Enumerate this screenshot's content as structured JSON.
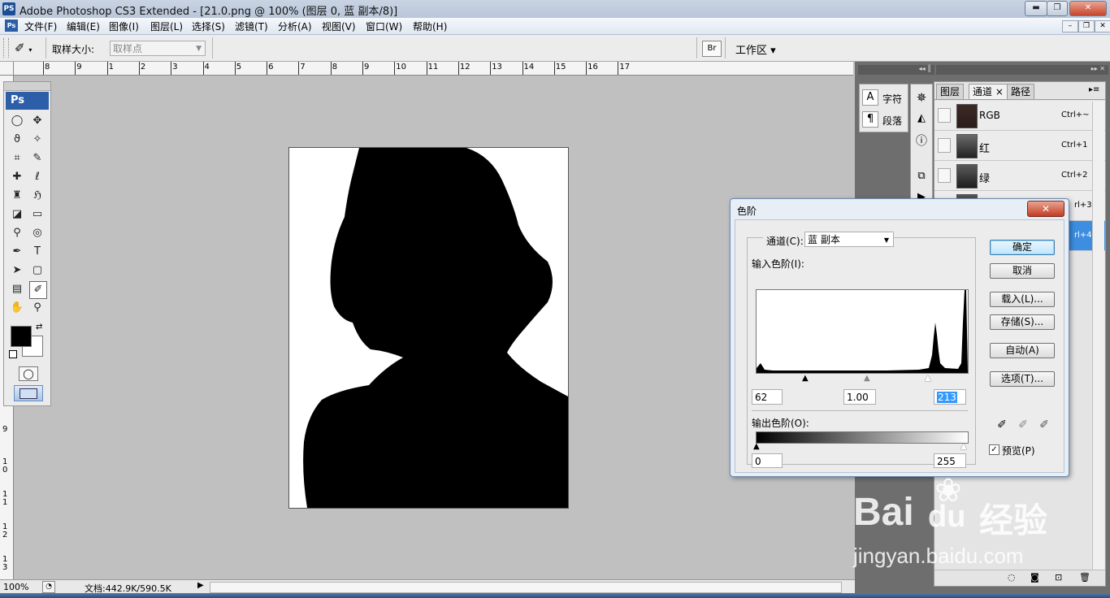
{
  "titlebar": {
    "app_icon": "PS",
    "title": "Adobe Photoshop CS3 Extended - [21.0.png @ 100% (图层 0, 蓝 副本/8)]",
    "minimize": "▬",
    "maximize": "❐",
    "close": "✕"
  },
  "menubar": {
    "app_icon": "Ps",
    "items": [
      "文件(F)",
      "编辑(E)",
      "图像(I)",
      "图层(L)",
      "选择(S)",
      "滤镜(T)",
      "分析(A)",
      "视图(V)",
      "窗口(W)",
      "帮助(H)"
    ],
    "mdi_minimize": "–",
    "mdi_restore": "❐",
    "mdi_close": "✕"
  },
  "options": {
    "tool_icon": "eyedropper-icon",
    "sample_size_label": "取样大小:",
    "sample_size_value": "取样点",
    "workspace_label": "工作区 ▾"
  },
  "ruler": {
    "top_labels": [
      "8",
      "9",
      "1",
      "2",
      "3",
      "4",
      "5",
      "6",
      "7",
      "8",
      "9",
      "10",
      "11",
      "12",
      "13",
      "14",
      "15",
      "16",
      "17"
    ],
    "left_labels": [
      "9",
      "1\n0",
      "1\n1",
      "1\n2",
      "1\n3"
    ]
  },
  "toolbox": {
    "logo": "Ps",
    "tools": [
      {
        "name": "marquee-icon",
        "glyph": "◯"
      },
      {
        "name": "move-icon",
        "glyph": "✥"
      },
      {
        "name": "lasso-icon",
        "glyph": "ϑ"
      },
      {
        "name": "magic-wand-icon",
        "glyph": "✧"
      },
      {
        "name": "crop-icon",
        "glyph": "⌗"
      },
      {
        "name": "slice-icon",
        "glyph": "✎"
      },
      {
        "name": "healing-brush-icon",
        "glyph": "✚"
      },
      {
        "name": "brush-icon",
        "glyph": "ℓ"
      },
      {
        "name": "stamp-icon",
        "glyph": "♜"
      },
      {
        "name": "history-brush-icon",
        "glyph": "ℌ"
      },
      {
        "name": "eraser-icon",
        "glyph": "◪"
      },
      {
        "name": "gradient-icon",
        "glyph": "▭"
      },
      {
        "name": "blur-icon",
        "glyph": "⚲"
      },
      {
        "name": "dodge-icon",
        "glyph": "◎"
      },
      {
        "name": "pen-icon",
        "glyph": "✒"
      },
      {
        "name": "type-icon",
        "glyph": "T"
      },
      {
        "name": "path-select-icon",
        "glyph": "➤"
      },
      {
        "name": "shape-icon",
        "glyph": "▢"
      },
      {
        "name": "notes-icon",
        "glyph": "▤"
      },
      {
        "name": "eyedropper-tool-icon",
        "glyph": "✐"
      },
      {
        "name": "hand-icon",
        "glyph": "✋"
      },
      {
        "name": "zoom-icon",
        "glyph": "⚲"
      }
    ]
  },
  "status": {
    "zoom": "100%",
    "doc_info": "文档:442.9K/590.5K"
  },
  "char_panel": {
    "char_label": "字符",
    "para_label": "段落"
  },
  "channels_panel": {
    "tabs": [
      "图层",
      "通道",
      "路径"
    ],
    "active_tab_close": "×",
    "rows": [
      {
        "name": "RGB",
        "shortcut": "Ctrl+~"
      },
      {
        "name": "红",
        "shortcut": "Ctrl+1"
      },
      {
        "name": "绿",
        "shortcut": "Ctrl+2"
      },
      {
        "name": "",
        "shortcut": "rl+3"
      },
      {
        "name": "",
        "shortcut": "rl+4"
      }
    ]
  },
  "levels_dialog": {
    "title": "色阶",
    "close": "✕",
    "channel_label": "通道(C):",
    "channel_value": "蓝 副本",
    "input_levels_label": "输入色阶(I):",
    "input_black": "62",
    "input_gamma": "1.00",
    "input_white": "213",
    "output_levels_label": "输出色阶(O):",
    "output_black": "0",
    "output_white": "255",
    "buttons": {
      "ok": "确定",
      "cancel": "取消",
      "load": "载入(L)...",
      "save": "存储(S)...",
      "auto": "自动(A)",
      "options": "选项(T)..."
    },
    "preview_label": "预览(P)",
    "preview_checked": true
  },
  "watermark": {
    "brand": "Bai",
    "brand_du": "du",
    "brand_cn": "经验",
    "url": "jingyan.baidu.com"
  }
}
